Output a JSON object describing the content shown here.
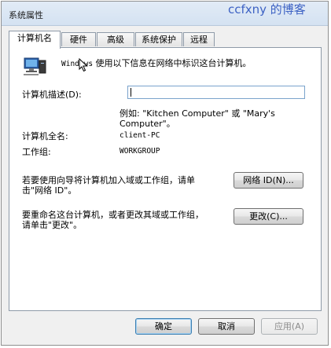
{
  "window": {
    "title": "系统属性"
  },
  "watermark": "ccfxny 的博客",
  "tabs": [
    {
      "label": "计算机名",
      "active": true
    },
    {
      "label": "硬件",
      "active": false
    },
    {
      "label": "高级",
      "active": false
    },
    {
      "label": "系统保护",
      "active": false
    },
    {
      "label": "远程",
      "active": false
    }
  ],
  "panel": {
    "intro_prefix": "Windows",
    "intro_text": " 使用以下信息在网络中标识这台计算机。",
    "description_label": "计算机描述(D):",
    "description_value": "",
    "example_line1": "例如: \"Kitchen Computer\" 或 \"Mary's",
    "example_line2": "Computer\"。",
    "full_name_label": "计算机全名:",
    "full_name_value": "client-PC",
    "workgroup_label": "工作组:",
    "workgroup_value": "WORKGROUP",
    "wizard_line1": "若要使用向导将计算机加入域或工作组，请单",
    "wizard_line2": "击\"网络 ID\"。",
    "network_id_button": "网络 ID(N)...",
    "rename_line1": "要重命名这台计算机，或者更改其域或工作组，",
    "rename_line2": "请单击\"更改\"。",
    "change_button": "更改(C)..."
  },
  "buttons": {
    "ok": "确定",
    "cancel": "取消",
    "apply": "应用(A)"
  },
  "icons": {
    "computer": "computer-icon",
    "cursor": "mouse-pointer-icon"
  }
}
